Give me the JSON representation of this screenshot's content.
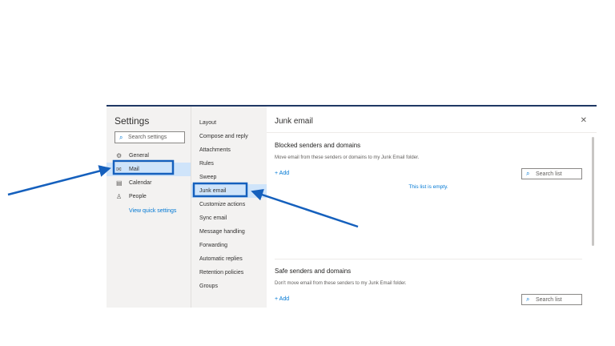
{
  "settings": {
    "title": "Settings",
    "search_placeholder": "Search settings",
    "nav": [
      {
        "label": "General",
        "icon": "gear-icon"
      },
      {
        "label": "Mail",
        "icon": "mail-icon"
      },
      {
        "label": "Calendar",
        "icon": "calendar-icon"
      },
      {
        "label": "People",
        "icon": "people-icon"
      }
    ],
    "quick_link": "View quick settings"
  },
  "mail_menu": [
    "Layout",
    "Compose and reply",
    "Attachments",
    "Rules",
    "Sweep",
    "Junk email",
    "Customize actions",
    "Sync email",
    "Message handling",
    "Forwarding",
    "Automatic replies",
    "Retention policies",
    "Groups"
  ],
  "panel": {
    "title": "Junk email",
    "blocked": {
      "title": "Blocked senders and domains",
      "desc": "Move email from these senders or domains to my Junk Email folder.",
      "add": "+ Add",
      "search": "Search list",
      "empty": "This list is empty."
    },
    "safe": {
      "title": "Safe senders and domains",
      "desc": "Don't move email from these senders to my Junk Email folder.",
      "add": "+ Add",
      "search": "Search list"
    }
  },
  "colors": {
    "accent": "#0078d4",
    "highlight": "#1560bd"
  }
}
